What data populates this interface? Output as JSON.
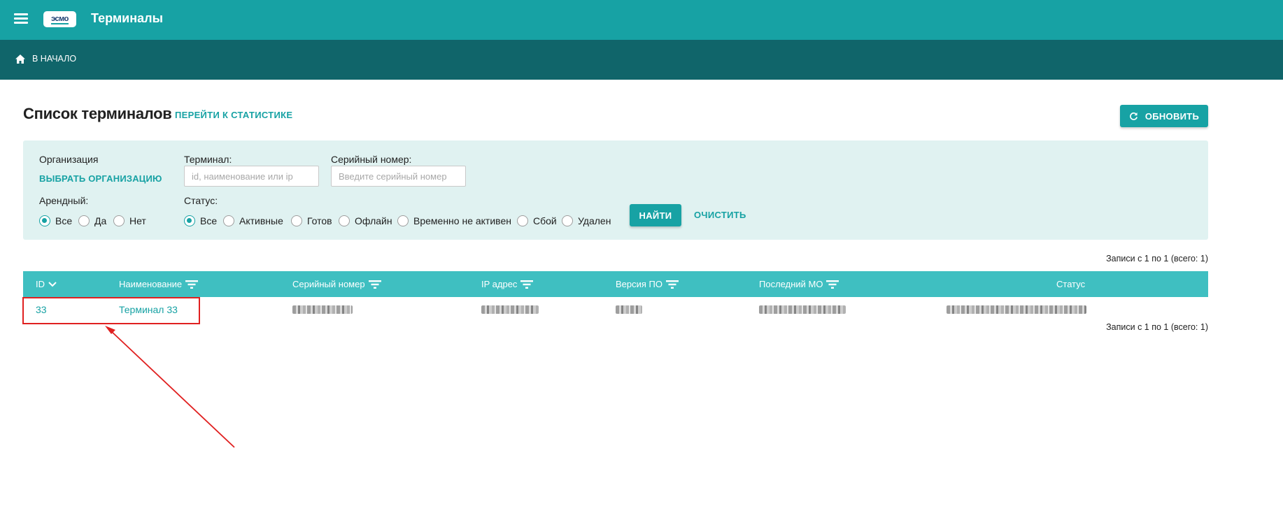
{
  "app": {
    "title": "Терминалы",
    "logo_text": "эсмо",
    "accent": "#17a2a4",
    "dark_accent": "#10656a"
  },
  "breadcrumb": {
    "home_label": "В НАЧАЛО"
  },
  "page": {
    "title": "Список терминалов",
    "stats_link": "ПЕРЕЙТИ К СТАТИСТИКЕ",
    "refresh_label": "ОБНОВИТЬ"
  },
  "filters": {
    "organization_label": "Организация",
    "select_org_link": "ВЫБРАТЬ ОРГАНИЗАЦИЮ",
    "terminal_label": "Терминал:",
    "terminal_placeholder": "id, наименование или ip",
    "serial_label": "Серийный номер:",
    "serial_placeholder": "Введите серийный номер",
    "rental_label": "Арендный:",
    "rental_options": [
      "Все",
      "Да",
      "Нет"
    ],
    "rental_selected": "Все",
    "status_label": "Статус:",
    "status_options": [
      "Все",
      "Активные",
      "Готов",
      "Офлайн",
      "Временно не активен",
      "Сбой",
      "Удален"
    ],
    "status_selected": "Все",
    "find_label": "НАЙТИ",
    "clear_label": "ОЧИСТИТЬ"
  },
  "records_info": "Записи с 1 по 1 (всего: 1)",
  "table": {
    "columns": [
      "ID",
      "Наименование",
      "Серийный номер",
      "IP адрес",
      "Версия ПО",
      "Последний МО",
      "Статус"
    ],
    "rows": [
      {
        "id": "33",
        "name": "Терминал 33"
      }
    ]
  },
  "annotation_color": "#e02020"
}
